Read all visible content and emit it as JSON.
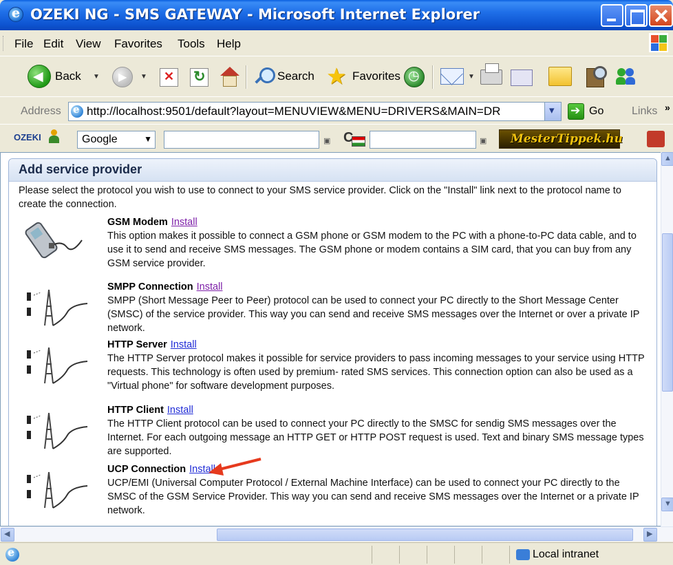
{
  "window": {
    "title": "OZEKI NG - SMS GATEWAY - Microsoft Internet Explorer"
  },
  "menu": [
    "File",
    "Edit",
    "View",
    "Favorites",
    "Tools",
    "Help"
  ],
  "toolbar": {
    "back": "Back",
    "search": "Search",
    "favorites": "Favorites"
  },
  "address": {
    "label": "Address",
    "url": "http://localhost:9501/default?layout=MENUVIEW&MENU=DRIVERS&MAIN=DR",
    "go": "Go",
    "links": "Links"
  },
  "search_toolbar": {
    "ozeki_logo": "OZEKI",
    "engine": "Google",
    "badge": "MesterTippek.hu"
  },
  "page": {
    "heading": "Add service provider",
    "intro": "Please select the protocol you wish to use to connect to your SMS service provider. Click on the \"Install\" link next to the protocol name to create the connection.",
    "providers": [
      {
        "name": "GSM Modem",
        "link": "Install",
        "description": "This option makes it possible to connect a GSM phone or GSM modem to the PC with a phone-to-PC data cable, and to use it to send and receive SMS messages. The GSM phone or modem contains a SIM card, that you can buy from any GSM service provider."
      },
      {
        "name": "SMPP Connection",
        "link": "Install",
        "description": "SMPP (Short Message Peer to Peer) protocol can be used to connect your PC directly to the Short Message Center (SMSC) of the service provider. This way you can send and receive SMS messages over the Internet or over a private IP network."
      },
      {
        "name": "HTTP Server",
        "link": "Install",
        "description": "The HTTP Server protocol makes it possible for service providers to pass incoming messages to your service using HTTP requests. This technology is often used by premium- rated SMS services. This connection option can also be used as a \"Virtual phone\" for software development purposes."
      },
      {
        "name": "HTTP Client",
        "link": "Install",
        "description": "The HTTP Client protocol can be used to connect your PC directly to the SMSC for sendig SMS messages over the Internet. For each outgoing message an HTTP GET or HTTP POST request is used. Text and binary SMS message types are supported."
      },
      {
        "name": "UCP Connection",
        "link": "Install",
        "description": "UCP/EMI (Universal Computer Protocol / External Machine Interface) can be used to connect your PC directly to the SMSC of the GSM Service Provider. This way you can send and receive SMS messages over the Internet or a private IP network."
      }
    ]
  },
  "status": {
    "zone": "Local intranet"
  },
  "colors": {
    "link": "#1f2bd6",
    "visited_link": "#7d1fa8",
    "annotation_arrow": "#e63a1e",
    "titlebar": "#0e55d2"
  }
}
